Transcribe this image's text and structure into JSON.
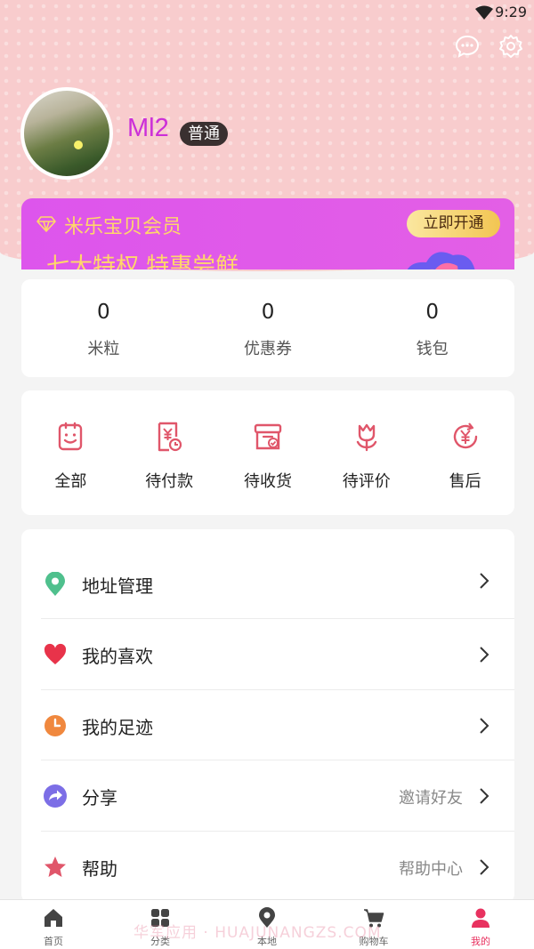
{
  "status_bar": {
    "time": "9:29"
  },
  "profile": {
    "username": "Ml2",
    "level": "普通"
  },
  "vip": {
    "title": "米乐宝贝会员",
    "button": "立即开通",
    "slogan": "七大特权 特惠尝鲜"
  },
  "stats": [
    {
      "value": "0",
      "label": "米粒"
    },
    {
      "value": "0",
      "label": "优惠券"
    },
    {
      "value": "0",
      "label": "钱包"
    }
  ],
  "orders": [
    {
      "label": "全部",
      "icon": "clipboard-icon"
    },
    {
      "label": "待付款",
      "icon": "yuan-bill-icon"
    },
    {
      "label": "待收货",
      "icon": "box-check-icon"
    },
    {
      "label": "待评价",
      "icon": "flower-icon"
    },
    {
      "label": "售后",
      "icon": "yuan-refresh-icon"
    }
  ],
  "menu": [
    {
      "label": "地址管理",
      "hint": "",
      "icon": "location-pin-icon",
      "color": "#4fc08d"
    },
    {
      "label": "我的喜欢",
      "hint": "",
      "icon": "heart-icon",
      "color": "#e8334a"
    },
    {
      "label": "我的足迹",
      "hint": "",
      "icon": "clock-icon",
      "color": "#f0883e"
    },
    {
      "label": "分享",
      "hint": "邀请好友",
      "icon": "share-icon",
      "color": "#7c6ee6"
    },
    {
      "label": "帮助",
      "hint": "帮助中心",
      "icon": "star-icon",
      "color": "#e0566a"
    }
  ],
  "tabbar": [
    {
      "label": "首页",
      "icon": "home-icon"
    },
    {
      "label": "分类",
      "icon": "grid-icon"
    },
    {
      "label": "本地",
      "icon": "location-icon"
    },
    {
      "label": "购物车",
      "icon": "cart-icon"
    },
    {
      "label": "我的",
      "icon": "user-icon",
      "active": true
    }
  ],
  "watermark": "华军应用 · HUAJUNANGZS.COM",
  "colors": {
    "accent": "#e8315f",
    "header_bg": "#f8cccd",
    "vip_bg": "#dd55ec",
    "vip_text": "#ffd76a"
  }
}
